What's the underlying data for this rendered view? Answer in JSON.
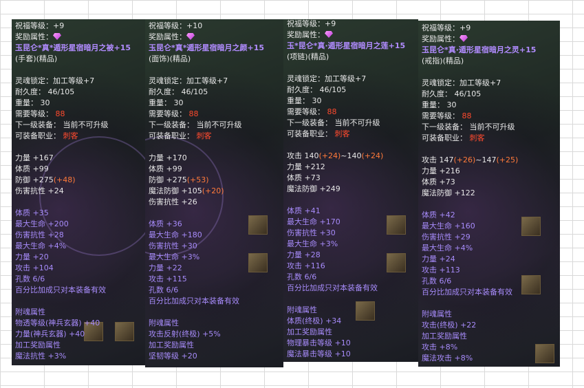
{
  "panels": [
    {
      "lines": [
        {
          "t": "祝福等级：+9",
          "c": "w"
        },
        {
          "t": "奖励属性：",
          "c": "w",
          "gem": true
        },
        {
          "t": "玉昆仑*真*遁形星宿暗月之被+15",
          "c": "pb"
        },
        {
          "t": "(手套)(精品)",
          "c": "w"
        },
        {
          "t": "",
          "c": "w"
        },
        {
          "t": "灵魂锁定：加工等级+7",
          "c": "w"
        },
        {
          "t": "耐久度： 46/105",
          "c": "w"
        },
        {
          "t": "重量： 30",
          "c": "w"
        },
        {
          "t": "需要等级： ",
          "c": "w",
          "x": "88",
          "xc": "r"
        },
        {
          "t": "下一级装备： 当前不可升级",
          "c": "w"
        },
        {
          "t": "可装备职业： ",
          "c": "w",
          "x": "刺客",
          "xc": "r"
        },
        {
          "t": "",
          "c": "w"
        },
        {
          "t": "力量 +167",
          "c": "w"
        },
        {
          "t": "体质 +99",
          "c": "w"
        },
        {
          "t": "防御 +275",
          "c": "w",
          "x": "(+48)",
          "xc": "o"
        },
        {
          "t": "伤害抗性 +24",
          "c": "w"
        },
        {
          "t": "",
          "c": "w"
        },
        {
          "t": "体质        +35",
          "c": "p"
        },
        {
          "t": "最大生命 +200",
          "c": "p"
        },
        {
          "t": "伤害抗性 +28",
          "c": "p"
        },
        {
          "t": "最大生命 +4%",
          "c": "p"
        },
        {
          "t": "力量        +20",
          "c": "p"
        },
        {
          "t": "攻击        +104",
          "c": "p"
        },
        {
          "t": "孔数 6/6",
          "c": "p"
        },
        {
          "t": "百分比加成只对本装备有效",
          "c": "p"
        },
        {
          "t": "",
          "c": "w"
        },
        {
          "t": "附魂属性",
          "c": "p"
        },
        {
          "t": "  物透等级(神兵玄器) +40",
          "c": "p"
        },
        {
          "t": "  力量(神兵玄器)  +40",
          "c": "p"
        },
        {
          "t": "加工奖励属性",
          "c": "p"
        },
        {
          "t": "魔法抗性 +3%",
          "c": "p"
        }
      ]
    },
    {
      "lines": [
        {
          "t": "祝福等级：+10",
          "c": "w"
        },
        {
          "t": "奖励属性：",
          "c": "w",
          "gem": true
        },
        {
          "t": "玉昆仑*真*遁形星宿暗月之颜+15",
          "c": "pb"
        },
        {
          "t": "(面饰)(精品)",
          "c": "w"
        },
        {
          "t": "",
          "c": "w"
        },
        {
          "t": "灵魂锁定：加工等级+7",
          "c": "w"
        },
        {
          "t": "耐久度： 46/105",
          "c": "w"
        },
        {
          "t": "重量： 30",
          "c": "w"
        },
        {
          "t": "需要等级： ",
          "c": "w",
          "x": "88",
          "xc": "r"
        },
        {
          "t": "下一级装备： 当前不可升级",
          "c": "w"
        },
        {
          "t": "可装备职业： ",
          "c": "w",
          "x": "刺客",
          "xc": "r"
        },
        {
          "t": "",
          "c": "w"
        },
        {
          "t": "力量 +170",
          "c": "w"
        },
        {
          "t": "体质 +99",
          "c": "w"
        },
        {
          "t": "防御 +275",
          "c": "w",
          "x": "(+53)",
          "xc": "o"
        },
        {
          "t": "魔法防御 +105",
          "c": "w",
          "x": "(+20)",
          "xc": "o"
        },
        {
          "t": "伤害抗性 +26",
          "c": "w"
        },
        {
          "t": "",
          "c": "w"
        },
        {
          "t": "体质        +36",
          "c": "p"
        },
        {
          "t": "最大生命 +180",
          "c": "p"
        },
        {
          "t": "伤害抗性 +30",
          "c": "p"
        },
        {
          "t": "最大生命 +3%",
          "c": "p"
        },
        {
          "t": "力量        +22",
          "c": "p"
        },
        {
          "t": "攻击        +115",
          "c": "p"
        },
        {
          "t": "孔数 6/6",
          "c": "p"
        },
        {
          "t": "百分比加成只对本装备有效",
          "c": "p"
        },
        {
          "t": "",
          "c": "w"
        },
        {
          "t": "附魂属性",
          "c": "p"
        },
        {
          "t": "  攻击反射(终极)  +5%",
          "c": "p"
        },
        {
          "t": "加工奖励属性",
          "c": "p"
        },
        {
          "t": "坚韧等级 +20",
          "c": "p"
        }
      ]
    },
    {
      "lines": [
        {
          "t": "祝福等级：+9",
          "c": "w"
        },
        {
          "t": "奖励属性：",
          "c": "w",
          "gem": true
        },
        {
          "t": "玉*昆仑*真·遁形星宿暗月之莲+15",
          "c": "pb"
        },
        {
          "t": "(项链)(精品)",
          "c": "w"
        },
        {
          "t": "",
          "c": "w"
        },
        {
          "t": "灵魂锁定：加工等级+7",
          "c": "w"
        },
        {
          "t": "耐久度： 46/105",
          "c": "w"
        },
        {
          "t": "重量： 30",
          "c": "w"
        },
        {
          "t": "需要等级： ",
          "c": "w",
          "x": "88",
          "xc": "r"
        },
        {
          "t": "下一级装备： 当前不可升级",
          "c": "w"
        },
        {
          "t": "可装备职业： ",
          "c": "w",
          "x": "刺客",
          "xc": "r"
        },
        {
          "t": "",
          "c": "w"
        },
        {
          "t": "攻击 140",
          "c": "w",
          "x": "(+24)",
          "xc": "o",
          "t2": "~140",
          "x2": "(+24)"
        },
        {
          "t": "力量 +212",
          "c": "w"
        },
        {
          "t": "体质 +73",
          "c": "w"
        },
        {
          "t": "魔法防御 +249",
          "c": "w"
        },
        {
          "t": "",
          "c": "w"
        },
        {
          "t": "体质        +41",
          "c": "p"
        },
        {
          "t": "最大生命 +170",
          "c": "p"
        },
        {
          "t": "伤害抗性 +30",
          "c": "p"
        },
        {
          "t": "最大生命 +3%",
          "c": "p"
        },
        {
          "t": "力量        +28",
          "c": "p"
        },
        {
          "t": "攻击        +116",
          "c": "p"
        },
        {
          "t": "孔数 6/6",
          "c": "p"
        },
        {
          "t": "百分比加成只对本装备有效",
          "c": "p"
        },
        {
          "t": "",
          "c": "w"
        },
        {
          "t": "附魂属性",
          "c": "p"
        },
        {
          "t": "  体质(终极)  +34",
          "c": "p"
        },
        {
          "t": "加工奖励属性",
          "c": "p"
        },
        {
          "t": "物理暴击等级 +10",
          "c": "p"
        },
        {
          "t": "魔法暴击等级 +10",
          "c": "p"
        }
      ]
    },
    {
      "lines": [
        {
          "t": "祝福等级：+9",
          "c": "w"
        },
        {
          "t": "奖励属性：",
          "c": "w",
          "gem": true
        },
        {
          "t": "玉昆仑*真·遁形星宿暗月之灵+15",
          "c": "pb"
        },
        {
          "t": "(戒指)(精品)",
          "c": "w"
        },
        {
          "t": "",
          "c": "w"
        },
        {
          "t": "灵魂锁定：加工等级+7",
          "c": "w"
        },
        {
          "t": "耐久度： 46/105",
          "c": "w"
        },
        {
          "t": "重量： 30",
          "c": "w"
        },
        {
          "t": "需要等级： ",
          "c": "w",
          "x": "88",
          "xc": "r"
        },
        {
          "t": "下一级装备： 当前不可升级",
          "c": "w"
        },
        {
          "t": "可装备职业： ",
          "c": "w",
          "x": "刺客",
          "xc": "r"
        },
        {
          "t": "",
          "c": "w"
        },
        {
          "t": "攻击 147",
          "c": "w",
          "x": "(+26)",
          "xc": "o",
          "t2": "~147",
          "x2": "(+25)"
        },
        {
          "t": "力量 +216",
          "c": "w"
        },
        {
          "t": "体质 +73",
          "c": "w"
        },
        {
          "t": "魔法防御 +122",
          "c": "w"
        },
        {
          "t": "",
          "c": "w"
        },
        {
          "t": "体质        +42",
          "c": "p"
        },
        {
          "t": "最大生命 +160",
          "c": "p"
        },
        {
          "t": "伤害抗性 +29",
          "c": "p"
        },
        {
          "t": "最大生命 +4%",
          "c": "p"
        },
        {
          "t": "力量        +24",
          "c": "p"
        },
        {
          "t": "攻击        +113",
          "c": "p"
        },
        {
          "t": "孔数 6/6",
          "c": "p"
        },
        {
          "t": "百分比加成只对本装备有效",
          "c": "p"
        },
        {
          "t": "",
          "c": "w"
        },
        {
          "t": "附魂属性",
          "c": "p"
        },
        {
          "t": "  攻击(终极)  +22",
          "c": "p"
        },
        {
          "t": "加工奖励属性",
          "c": "p"
        },
        {
          "t": "攻击        +8%",
          "c": "p"
        },
        {
          "t": "魔法攻击 +8%",
          "c": "p"
        }
      ]
    }
  ],
  "colors": {
    "white": "#e8e8e8",
    "purple": "#a78bfa",
    "red": "#ff4a2e",
    "orange": "#ff7a3a"
  }
}
